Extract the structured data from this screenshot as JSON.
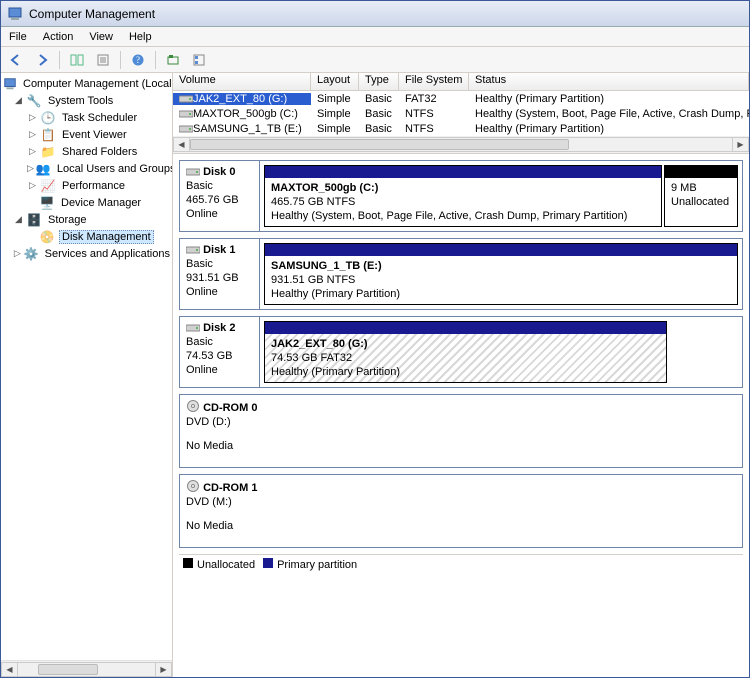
{
  "window": {
    "title": "Computer Management"
  },
  "menu": {
    "file": "File",
    "action": "Action",
    "view": "View",
    "help": "Help"
  },
  "tree": {
    "root": "Computer Management (Local",
    "systools": "System Tools",
    "task": "Task Scheduler",
    "event": "Event Viewer",
    "shared": "Shared Folders",
    "local": "Local Users and Groups",
    "perf": "Performance",
    "devmgr": "Device Manager",
    "storage": "Storage",
    "diskmgmt": "Disk Management",
    "services": "Services and Applications"
  },
  "vol_header": {
    "volume": "Volume",
    "layout": "Layout",
    "type": "Type",
    "fs": "File System",
    "status": "Status"
  },
  "volumes": [
    {
      "icon": "drive",
      "name": "JAK2_EXT_80 (G:)",
      "layout": "Simple",
      "type": "Basic",
      "fs": "FAT32",
      "status": "Healthy (Primary Partition)",
      "selected": true
    },
    {
      "icon": "drive",
      "name": "MAXTOR_500gb (C:)",
      "layout": "Simple",
      "type": "Basic",
      "fs": "NTFS",
      "status": "Healthy (System, Boot, Page File, Active, Crash Dump, Primary Partition",
      "selected": false
    },
    {
      "icon": "drive",
      "name": "SAMSUNG_1_TB (E:)",
      "layout": "Simple",
      "type": "Basic",
      "fs": "NTFS",
      "status": "Healthy (Primary Partition)",
      "selected": false
    }
  ],
  "disks": {
    "d0": {
      "title": "Disk 0",
      "type": "Basic",
      "size": "465.76 GB",
      "state": "Online",
      "p0": {
        "title": "MAXTOR_500gb  (C:)",
        "line1": "465.75 GB NTFS",
        "line2": "Healthy (System, Boot, Page File, Active, Crash Dump, Primary Partition)"
      },
      "un": {
        "line1": "9 MB",
        "line2": "Unallocated"
      }
    },
    "d1": {
      "title": "Disk 1",
      "type": "Basic",
      "size": "931.51 GB",
      "state": "Online",
      "p0": {
        "title": "SAMSUNG_1_TB  (E:)",
        "line1": "931.51 GB NTFS",
        "line2": "Healthy (Primary Partition)"
      }
    },
    "d2": {
      "title": "Disk 2",
      "type": "Basic",
      "size": "74.53 GB",
      "state": "Online",
      "p0": {
        "title": "JAK2_EXT_80  (G:)",
        "line1": "74.53 GB FAT32",
        "line2": "Healthy (Primary Partition)"
      }
    },
    "cd0": {
      "title": "CD-ROM 0",
      "type": "DVD (D:)",
      "line": "No Media"
    },
    "cd1": {
      "title": "CD-ROM 1",
      "type": "DVD (M:)",
      "line": "No Media"
    }
  },
  "legend": {
    "unalloc": "Unallocated",
    "primary": "Primary partition"
  }
}
